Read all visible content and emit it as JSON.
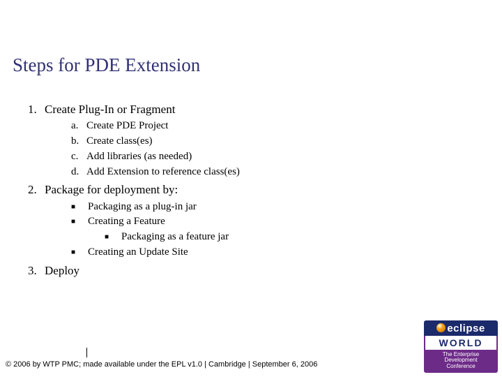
{
  "title": "Steps for PDE Extension",
  "list": {
    "i1": {
      "num": "1.",
      "text": "Create Plug-In or Fragment"
    },
    "i1a": {
      "ltr": "a.",
      "text": "Create PDE Project"
    },
    "i1b": {
      "ltr": "b.",
      "text": "Create class(es)"
    },
    "i1c": {
      "ltr": "c.",
      "text": "Add libraries (as needed)"
    },
    "i1d": {
      "ltr": "d.",
      "text": "Add Extension to reference class(es)"
    },
    "i2": {
      "num": "2.",
      "text": "Package for deployment by:"
    },
    "i2s1": {
      "text": "Packaging as a plug-in jar"
    },
    "i2s2": {
      "text": "Creating a Feature"
    },
    "i2s2a": {
      "text": "Packaging as a feature jar"
    },
    "i2s3": {
      "text": "Creating an Update Site"
    },
    "i3": {
      "num": "3.",
      "text": "Deploy"
    }
  },
  "bullet": {
    "square": "■"
  },
  "footer": "© 2006 by WTP PMC; made available under the EPL v1.0  |  Cambridge  |  September 6, 2006",
  "logo": {
    "brand": "eclipse",
    "world": "WORLD",
    "tag1": "The Enterprise",
    "tag2": "Development",
    "tag3": "Conference"
  }
}
